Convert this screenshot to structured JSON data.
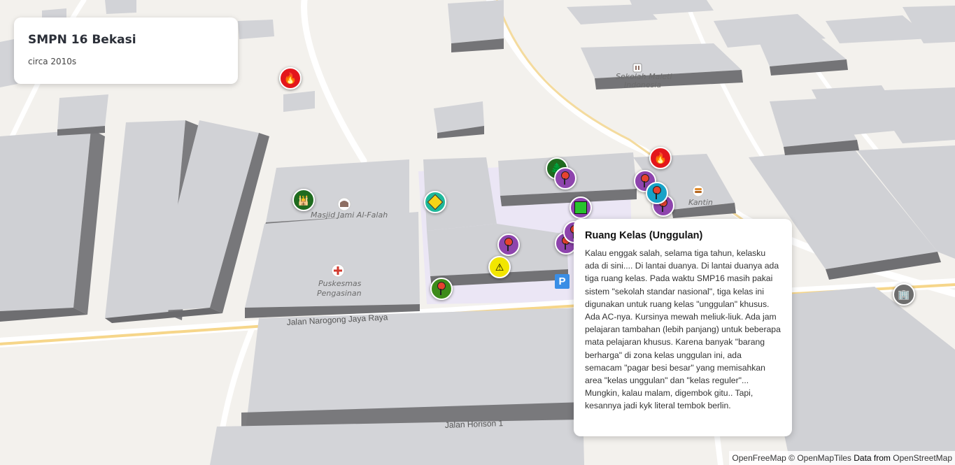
{
  "title_card": {
    "title": "SMPN 16 Bekasi",
    "subtitle": "circa 2010s"
  },
  "popup": {
    "title": "Ruang Kelas (Unggulan)",
    "body": "Kalau enggak salah, selama tiga tahun, kelasku ada di sini.... Di lantai duanya. Di lantai duanya ada tiga ruang kelas. Pada waktu SMP16 masih pakai sistem \"sekolah standar nasional\", tiga kelas ini digunakan untuk ruang kelas \"unggulan\" khusus. Ada AC-nya. Kursinya mewah meliuk-liuk. Ada jam pelajaran tambahan (lebih panjang) untuk beberapa mata pelajaran khusus. Karena banyak \"barang berharga\" di zona kelas unggulan ini, ada semacam \"pagar besi besar\" yang memisahkan area \"kelas unggulan\" dan \"kelas reguler\"... Mungkin, kalau malam, digembok gitu.. Tapi, kesannya jadi kyk literal tembok berlin."
  },
  "map_labels": {
    "masjid": "Masjid Jami Al-Falah",
    "puskesmas_1": "Puskesmas",
    "puskesmas_2": "Pengasinan",
    "kantin": "Kantin",
    "sekolah_1": "Sekolah Maleti",
    "sekolah_2": "Indonesia",
    "jalan_narogong": "Jalan Narogong Jaya Raya",
    "jalan_horison": "Jalan Horison 1",
    "parking": "P"
  },
  "markers": [
    {
      "name": "fire-marker-1",
      "color": "#e3161c",
      "icon": "fire-icon"
    },
    {
      "name": "fire-marker-2",
      "color": "#e3161c",
      "icon": "fire-icon"
    },
    {
      "name": "tree-marker",
      "color": "#1f6b1f",
      "icon": "tree-icon"
    },
    {
      "name": "mosque-marker",
      "color": "#1f6b1f",
      "icon": "mosque-icon"
    },
    {
      "name": "crossing-marker",
      "color": "#1eb89a",
      "icon": "crossing-icon"
    },
    {
      "name": "warning-marker",
      "color": "#f2e600",
      "icon": "warning-icon"
    },
    {
      "name": "green-pin-marker",
      "color": "#3d8b1a",
      "icon": "pin-icon"
    },
    {
      "name": "purple-pin-marker",
      "color": "#8e44ad",
      "icon": "pin-icon"
    },
    {
      "name": "teal-pin-marker",
      "color": "#17a2c7",
      "icon": "pin-icon"
    },
    {
      "name": "square-marker",
      "color": "#8e44ad",
      "icon": "square-icon"
    },
    {
      "name": "building-marker",
      "color": "#6d6d6d",
      "icon": "building-icon"
    }
  ],
  "attribution": {
    "openfreemap": "OpenFreeMap",
    "omt": "© OpenMapTiles",
    "data_from": "Data from",
    "osm": "OpenStreetMap"
  }
}
